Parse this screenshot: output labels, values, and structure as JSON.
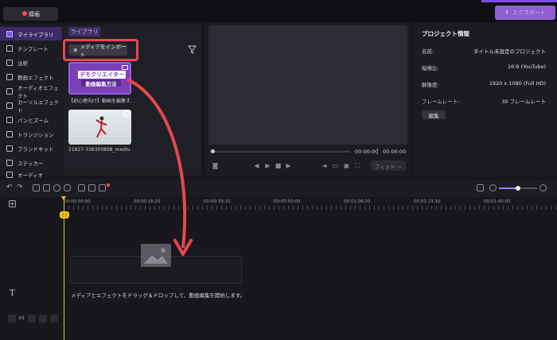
{
  "topbar": {
    "record_label": "録画",
    "export_label": "エクスポート"
  },
  "sidebar": {
    "items": [
      {
        "label": "マイライブラリ",
        "active": true
      },
      {
        "label": "テンプレート"
      },
      {
        "label": "注釈"
      },
      {
        "label": "動画エフェクト"
      },
      {
        "label": "オーディオエフェクト"
      },
      {
        "label": "カーソルエフェクト"
      },
      {
        "label": "パンとズーム"
      },
      {
        "label": "トランジション"
      },
      {
        "label": "ブランドキット"
      },
      {
        "label": "ステッカー"
      },
      {
        "label": "オーディオ"
      }
    ]
  },
  "library": {
    "tab_label": "ライブラリ",
    "import_label": "メディアをインポート",
    "items": [
      {
        "caption": "【初心者向け】動画を編集す...",
        "banner_top": "デモクリエイター",
        "banner_bottom": "動画編集方法"
      },
      {
        "caption": "21827-336300898_mediu..."
      }
    ]
  },
  "preview": {
    "time_current": "00:00:00",
    "time_total": "00:00:00",
    "fit_label": "フィット"
  },
  "project": {
    "title": "プロジェクト情報",
    "rows": [
      {
        "label": "名前:",
        "value": "タイトル未設定のプロジェクト"
      },
      {
        "label": "縦横比:",
        "value": "16:9 (YouTube)"
      },
      {
        "label": "解像度:",
        "value": "1920 x 1080 (Full HD)"
      },
      {
        "label": "フレームレート:",
        "value": "30 フレームレート"
      }
    ],
    "edit_label": "編集"
  },
  "timeline": {
    "ticks": [
      "00:00:00:00",
      "00:00:16:20",
      "00:00:33:10",
      "00:00:50:00",
      "00:01:06:20",
      "00:01:23:10",
      "00:01:40:00"
    ],
    "playhead_label": "[ ]",
    "drop_hint": "メディアとエフェクトをドラッグ＆ドロップして、動画編集を開始します。",
    "track_number": "01"
  },
  "colors": {
    "accent": "#a46cf5",
    "highlight": "#e5484d",
    "playhead": "#f5c518"
  }
}
